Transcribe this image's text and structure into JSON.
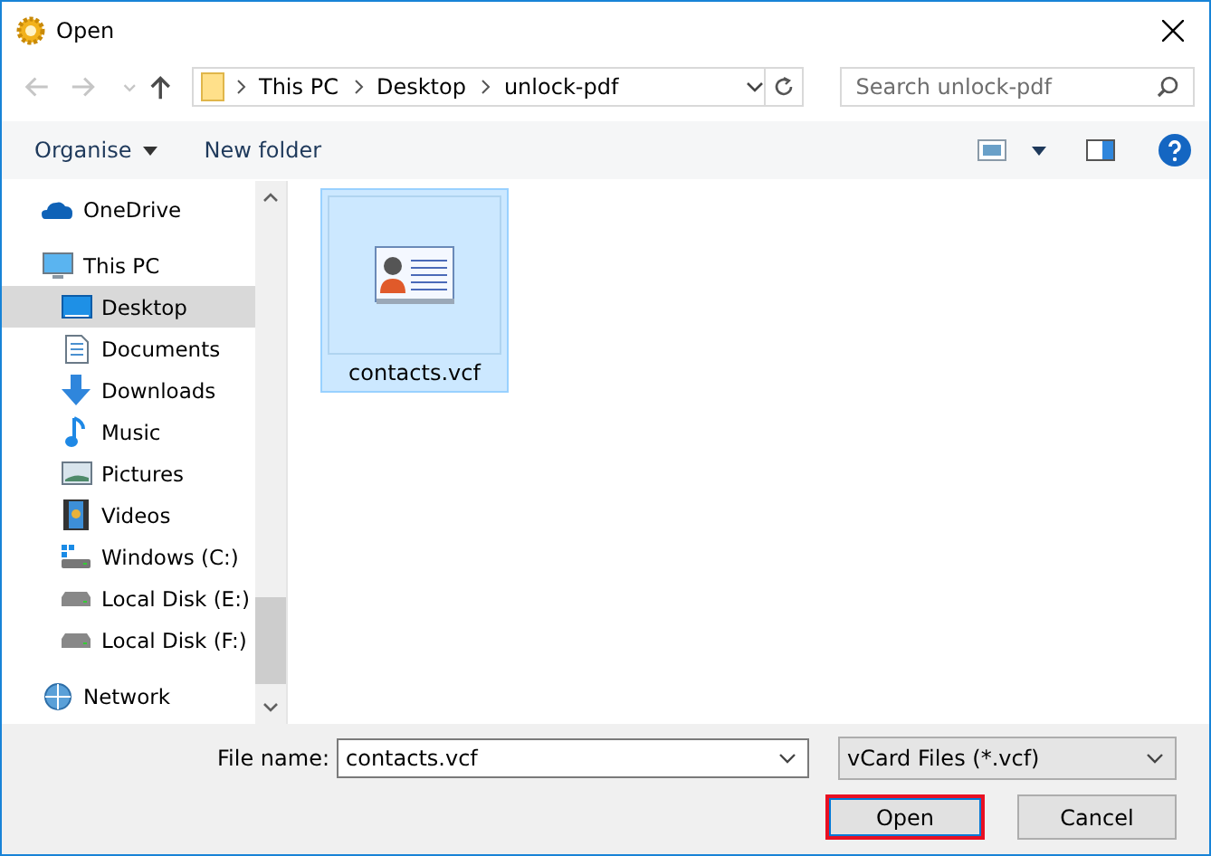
{
  "window": {
    "title": "Open"
  },
  "navigation": [
    {
      "kind": "back",
      "disabled": true
    },
    {
      "kind": "forward",
      "disabled": true
    },
    {
      "kind": "recent",
      "disabled": true
    },
    {
      "kind": "up",
      "disabled": false
    }
  ],
  "breadcrumb": [
    "This PC",
    "Desktop",
    "unlock-pdf"
  ],
  "search": {
    "placeholder": "Search unlock-pdf"
  },
  "toolbar": {
    "buttons": [
      "Organise",
      "New folder"
    ]
  },
  "sidebar": {
    "items": [
      {
        "label": "OneDrive",
        "kind": "cloud",
        "selected": false
      },
      {
        "label": "This PC",
        "kind": "pc",
        "selected": false,
        "children": [
          {
            "label": "Desktop",
            "kind": "desktop",
            "selected": true
          },
          {
            "label": "Documents",
            "kind": "documents",
            "selected": false
          },
          {
            "label": "Downloads",
            "kind": "downloads",
            "selected": false
          },
          {
            "label": "Music",
            "kind": "music",
            "selected": false
          },
          {
            "label": "Pictures",
            "kind": "pictures",
            "selected": false
          },
          {
            "label": "Videos",
            "kind": "videos",
            "selected": false
          },
          {
            "label": "Windows (C:)",
            "kind": "systemdrive",
            "selected": false
          },
          {
            "label": "Local Disk (E:)",
            "kind": "drive",
            "selected": false
          },
          {
            "label": "Local Disk (F:)",
            "kind": "drive",
            "selected": false
          }
        ]
      },
      {
        "label": "Network",
        "kind": "network",
        "selected": false
      }
    ]
  },
  "files": [
    {
      "name": "contacts.vcf",
      "selected": true
    }
  ],
  "footer": {
    "file_name_label": "File name:",
    "file_name_value": "contacts.vcf",
    "file_type": "vCard Files (*.vcf)",
    "buttons": [
      {
        "label": "Open",
        "default": true
      },
      {
        "label": "Cancel",
        "default": false
      }
    ]
  }
}
